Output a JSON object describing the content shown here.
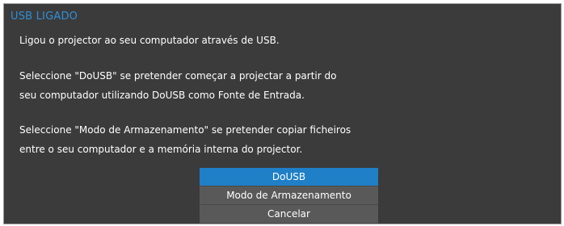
{
  "dialog": {
    "title": "USB LIGADO",
    "lines": [
      "Ligou o projector ao seu computador através de USB.",
      "Seleccione \"DoUSB\" se pretender começar a projectar a partir do",
      "seu computador utilizando DoUSB como Fonte de Entrada.",
      "Seleccione \"Modo de Armazenamento\" se pretender copiar ficheiros",
      "entre o seu computador e a memória interna do projector."
    ],
    "options": [
      {
        "label": "DoUSB",
        "selected": true
      },
      {
        "label": "Modo de Armazenamento",
        "selected": false
      },
      {
        "label": "Cancelar",
        "selected": false
      }
    ]
  },
  "colors": {
    "background": "#3b3b3b",
    "title": "#2e8fd8",
    "selected": "#1f7fc7",
    "option": "#595959"
  }
}
